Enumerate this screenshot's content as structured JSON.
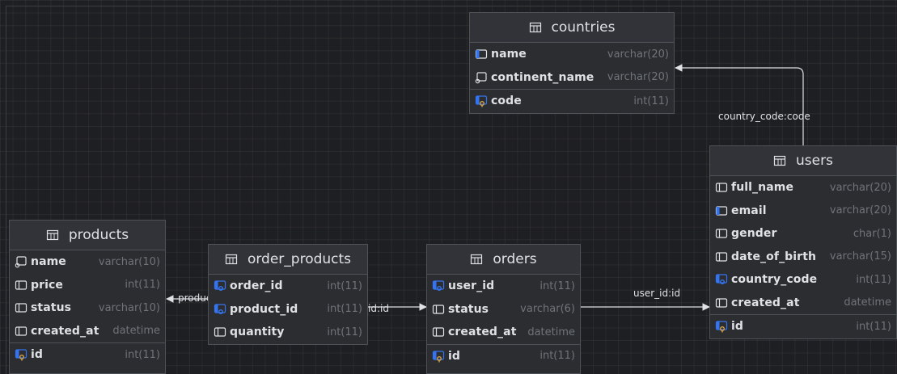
{
  "tables": {
    "countries": {
      "name": "countries",
      "columns": [
        {
          "name": "name",
          "type": "varchar(20)"
        },
        {
          "name": "continent_name",
          "type": "varchar(20)"
        },
        {
          "name": "code",
          "type": "int(11)"
        }
      ]
    },
    "users": {
      "name": "users",
      "columns": [
        {
          "name": "full_name",
          "type": "varchar(20)"
        },
        {
          "name": "email",
          "type": "varchar(20)"
        },
        {
          "name": "gender",
          "type": "char(1)"
        },
        {
          "name": "date_of_birth",
          "type": "varchar(15)"
        },
        {
          "name": "country_code",
          "type": "int(11)"
        },
        {
          "name": "created_at",
          "type": "datetime"
        },
        {
          "name": "id",
          "type": "int(11)"
        }
      ]
    },
    "products": {
      "name": "products",
      "columns": [
        {
          "name": "name",
          "type": "varchar(10)"
        },
        {
          "name": "price",
          "type": "int(11)"
        },
        {
          "name": "status",
          "type": "varchar(10)"
        },
        {
          "name": "created_at",
          "type": "datetime"
        },
        {
          "name": "id",
          "type": "int(11)"
        }
      ]
    },
    "order_products": {
      "name": "order_products",
      "columns": [
        {
          "name": "order_id",
          "type": "int(11)"
        },
        {
          "name": "product_id",
          "type": "int(11)"
        },
        {
          "name": "quantity",
          "type": "int(11)"
        }
      ]
    },
    "orders": {
      "name": "orders",
      "columns": [
        {
          "name": "user_id",
          "type": "int(11)"
        },
        {
          "name": "status",
          "type": "varchar(6)"
        },
        {
          "name": "created_at",
          "type": "datetime"
        },
        {
          "name": "id",
          "type": "int(11)"
        }
      ]
    }
  },
  "relations": {
    "country_code": "country_code:code",
    "user_id": "user_id:id",
    "order_id": "order_id:id",
    "product_id": "product_id:id"
  },
  "icons": {
    "table": "table-icon",
    "column": "column-icon",
    "foreign_key": "foreign-key-column-icon",
    "primary_key": "primary-key-column-icon",
    "index": "indexed-column-icon"
  },
  "colors": {
    "background": "#1e1f22",
    "table_bg": "#2b2d30",
    "key_blue": "#3574f0",
    "key_gold": "#d9a343",
    "type_gray": "#6f737a"
  }
}
